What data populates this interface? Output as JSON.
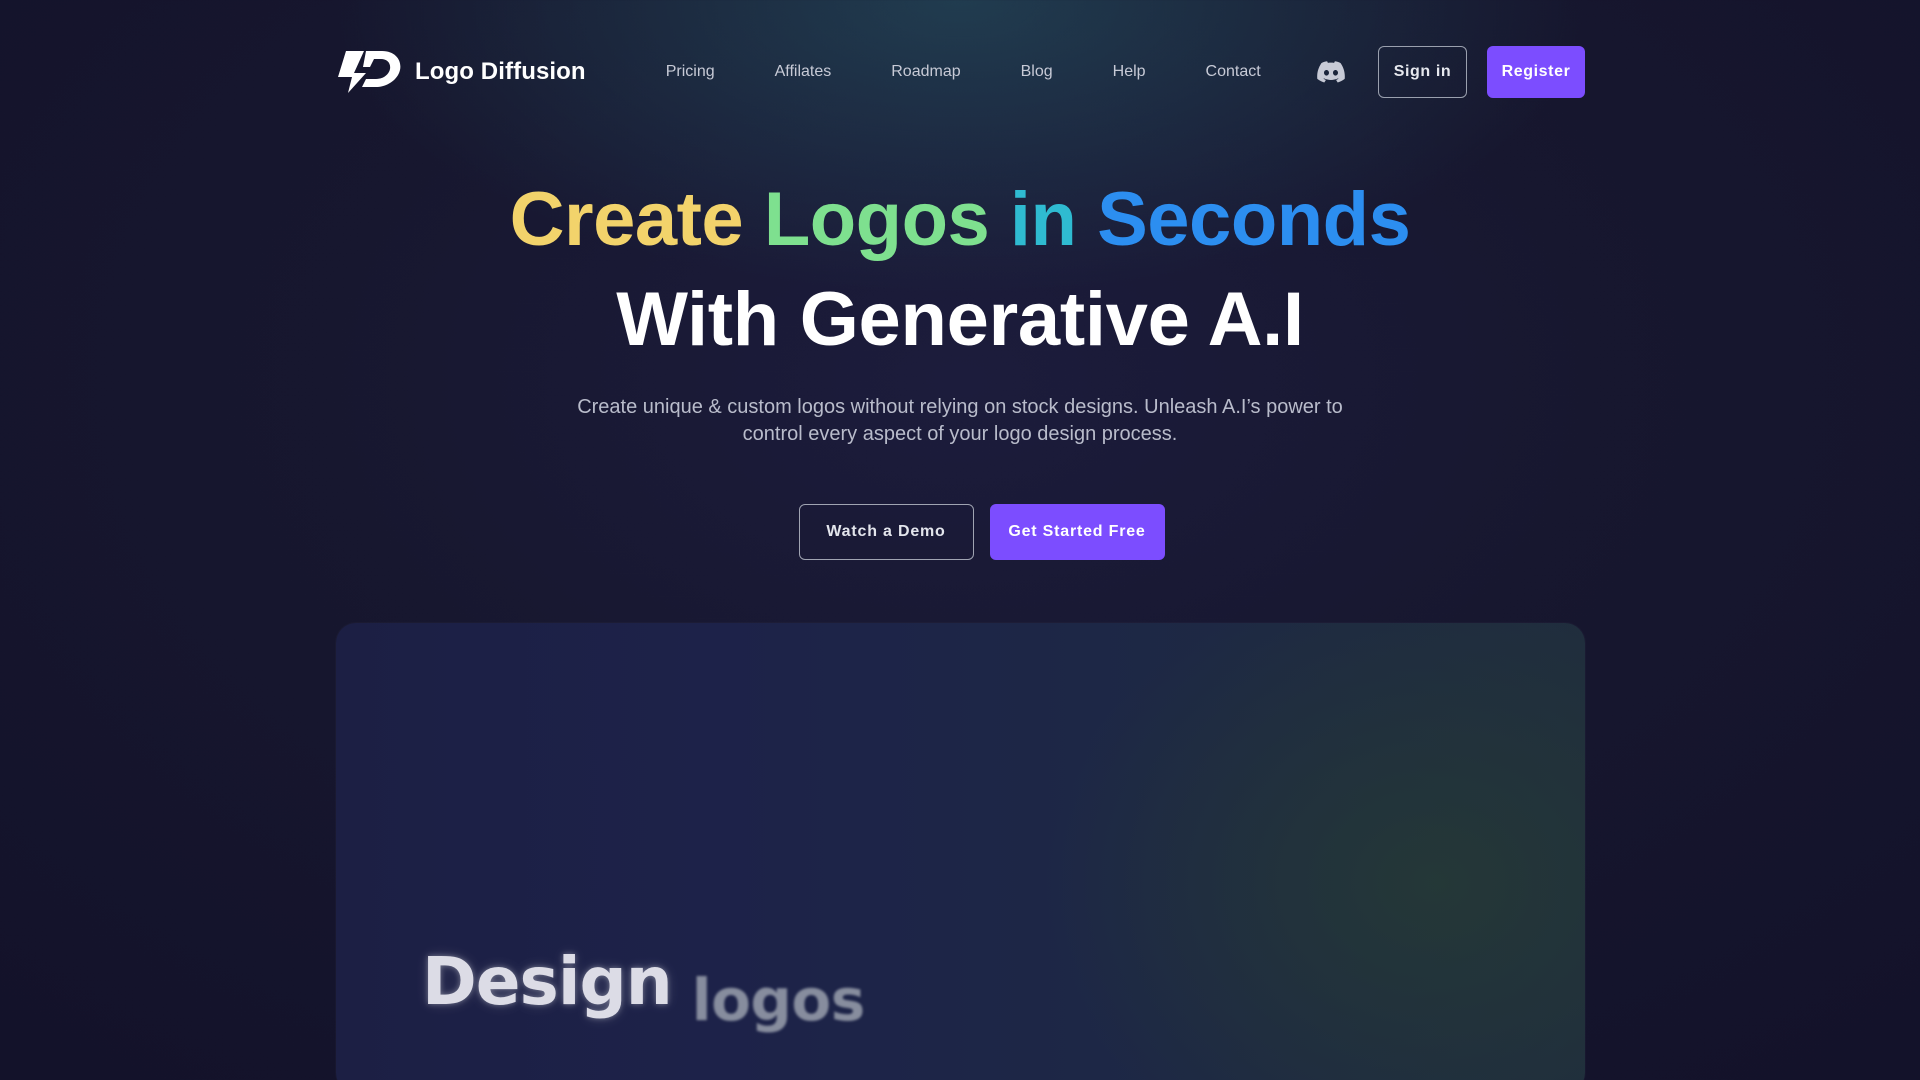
{
  "brand": {
    "name": "Logo Diffusion",
    "logo_icon": "logo-diffusion-mark"
  },
  "nav": {
    "links": [
      {
        "label": "Pricing"
      },
      {
        "label": "Affilates"
      },
      {
        "label": "Roadmap"
      },
      {
        "label": "Blog"
      },
      {
        "label": "Help"
      },
      {
        "label": "Contact"
      }
    ],
    "discord_icon": "discord-icon",
    "signin_label": "Sign in",
    "register_label": "Register"
  },
  "hero": {
    "headline_line1": [
      "Create",
      "Logos",
      "in",
      "Seconds"
    ],
    "headline_line2": "With Generative A.I",
    "subtitle": "Create unique & custom logos without relying on stock designs. Unleash A.I’s power to control every aspect of your logo design process.",
    "demo_label": "Watch a Demo",
    "start_label": "Get Started Free"
  },
  "showcase": {
    "word1": "Design",
    "word2": "logos"
  },
  "colors": {
    "accent": "#7c4dff",
    "gradient": [
      "#f6cf6a",
      "#7ee08f",
      "#2fbbd1",
      "#2a86f2"
    ]
  }
}
